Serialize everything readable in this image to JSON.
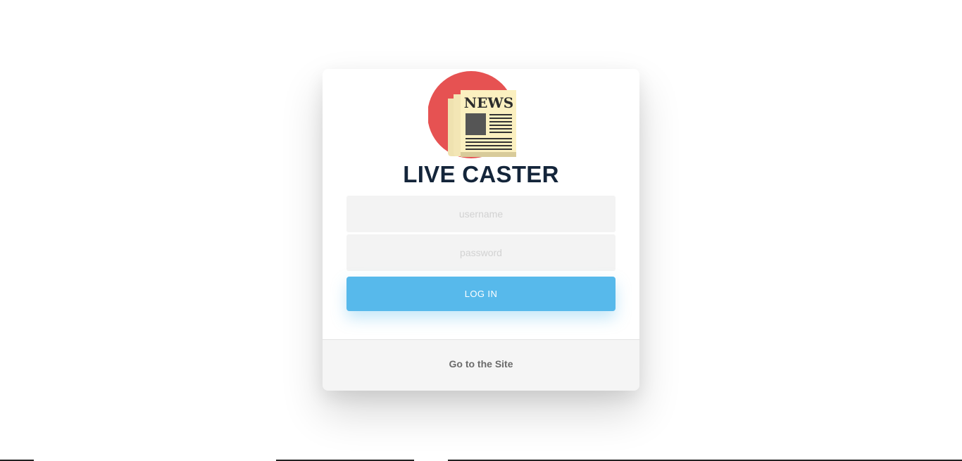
{
  "brand": {
    "title": "LIVE CASTER",
    "logo_icon": "newspaper-icon",
    "logo_text": "NEWS",
    "colors": {
      "circle": "#e65252",
      "paper": "#fbf0c0",
      "ink": "#333333"
    }
  },
  "login_form": {
    "username_placeholder": "username",
    "username_value": "",
    "password_placeholder": "password",
    "password_value": "",
    "submit_label": "LOG IN",
    "accent_color": "#57b9eb"
  },
  "footer": {
    "link_label": "Go to the Site"
  }
}
